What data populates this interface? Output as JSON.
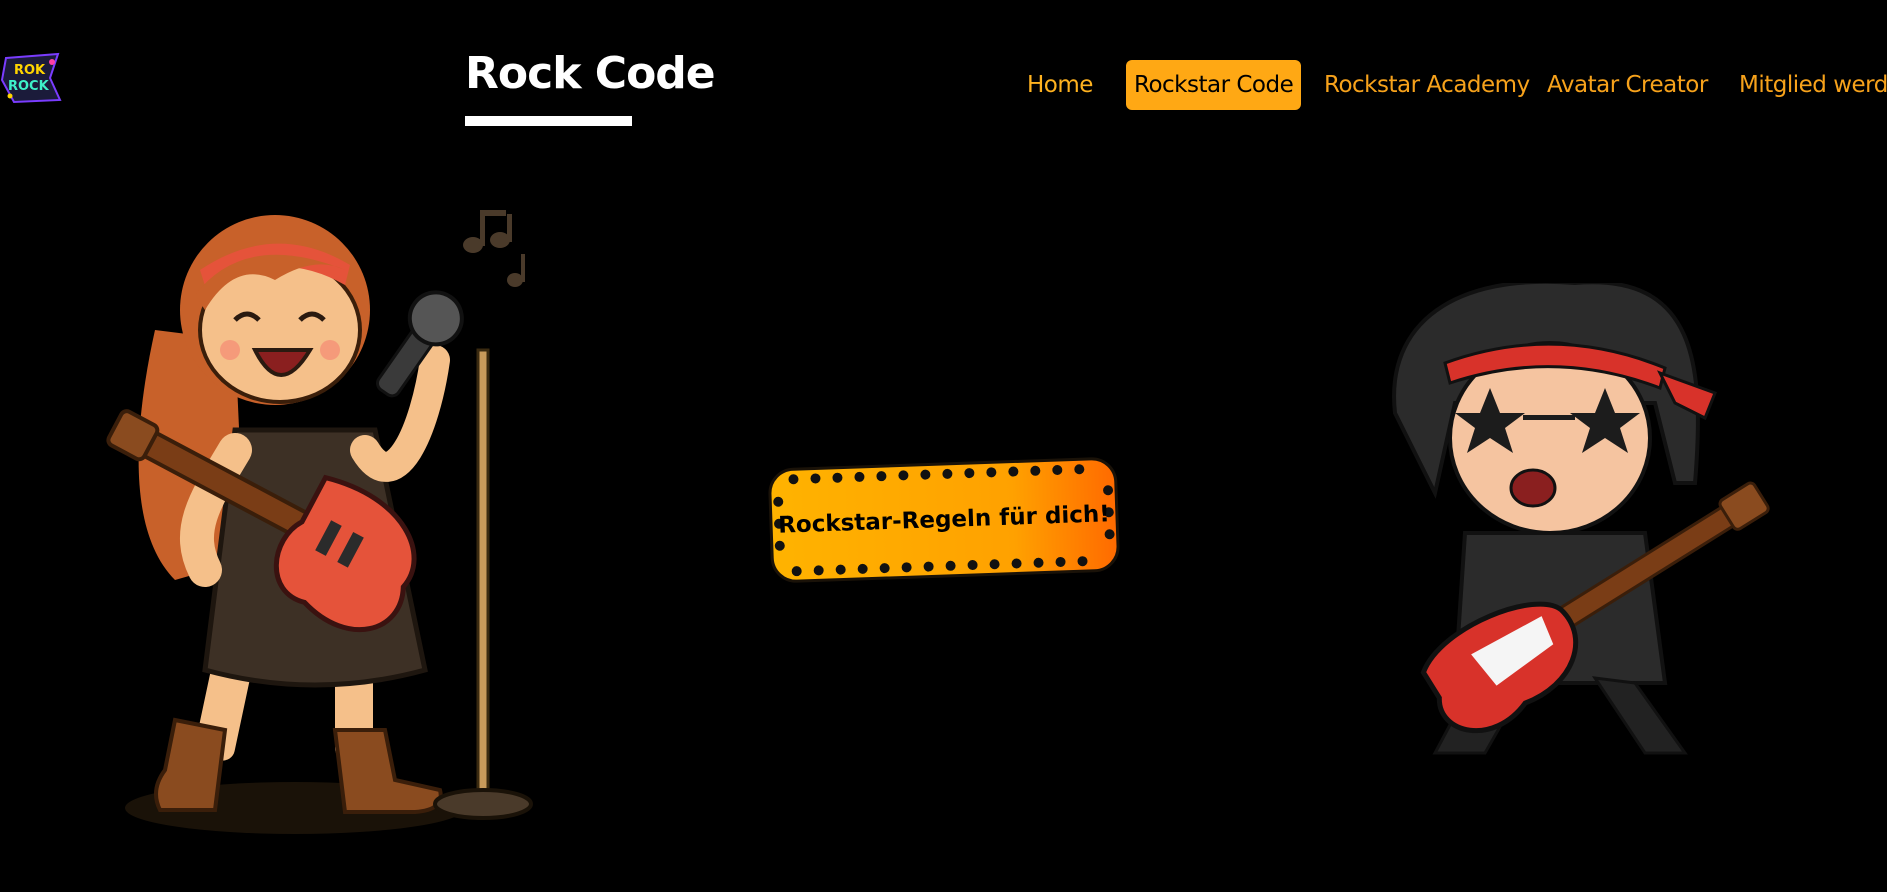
{
  "header": {
    "title": "Rock Code",
    "logo_text": [
      "ROK",
      "ROCK"
    ]
  },
  "nav": {
    "items": [
      {
        "label": "Home"
      },
      {
        "label": "Rockstar Code",
        "active": true
      },
      {
        "label": "Rockstar Academy"
      },
      {
        "label": "Avatar Creator"
      },
      {
        "label": "Mitglied werden"
      }
    ]
  },
  "main": {
    "cta_label": "Rockstar-Regeln für dich!"
  },
  "colors": {
    "background": "#000000",
    "nav_text": "#f7a21b",
    "active_bg": "#ffa814",
    "cta_gradient_start": "#ffb300",
    "cta_gradient_end": "#ff6a00"
  },
  "icons": [
    "logo-badge",
    "girl-rockstar-illustration",
    "boy-rockstar-illustration",
    "music-note-icon"
  ]
}
